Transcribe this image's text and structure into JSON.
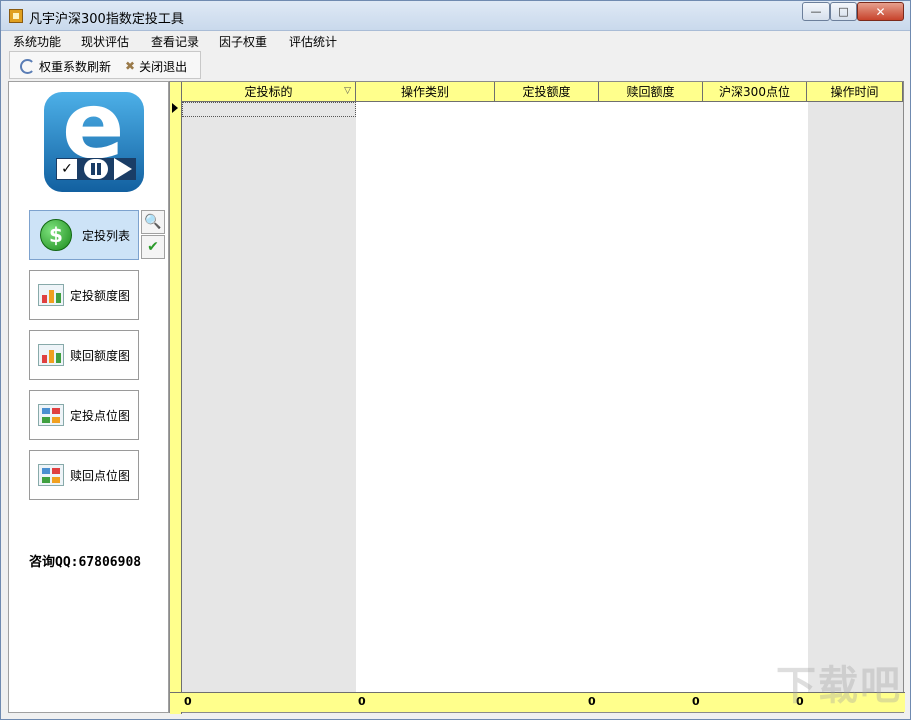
{
  "window": {
    "title": "凡宇沪深300指数定投工具",
    "controls": {
      "minimize": "—",
      "maximize": "□",
      "close": "✕"
    }
  },
  "menu": [
    "系统功能",
    "现状评估",
    "查看记录",
    "因子权重",
    "评估统计"
  ],
  "toolbar": {
    "refresh_label": "权重系数刷新",
    "exit_label": "关闭退出"
  },
  "sidebar": {
    "nav": [
      {
        "label": "定投列表",
        "icon": "dollar-icon"
      },
      {
        "label": "定投额度图",
        "icon": "bar-chart-icon"
      },
      {
        "label": "赎回额度图",
        "icon": "bar-chart-icon"
      },
      {
        "label": "定投点位图",
        "icon": "grid-chart-icon"
      },
      {
        "label": "赎回点位图",
        "icon": "grid-chart-icon"
      }
    ],
    "tools": [
      {
        "icon": "search-icon",
        "glyph": "🔍"
      },
      {
        "icon": "check-icon",
        "glyph": "✔"
      }
    ],
    "consult": "咨询QQ:67806908"
  },
  "grid": {
    "columns": [
      "定投标的",
      "操作类别",
      "定投额度",
      "赎回额度",
      "沪深300点位",
      "操作时间"
    ],
    "filter_mark": "▽",
    "footer": [
      "0",
      "0",
      "0",
      "0",
      "0"
    ]
  },
  "watermark": "下载吧"
}
